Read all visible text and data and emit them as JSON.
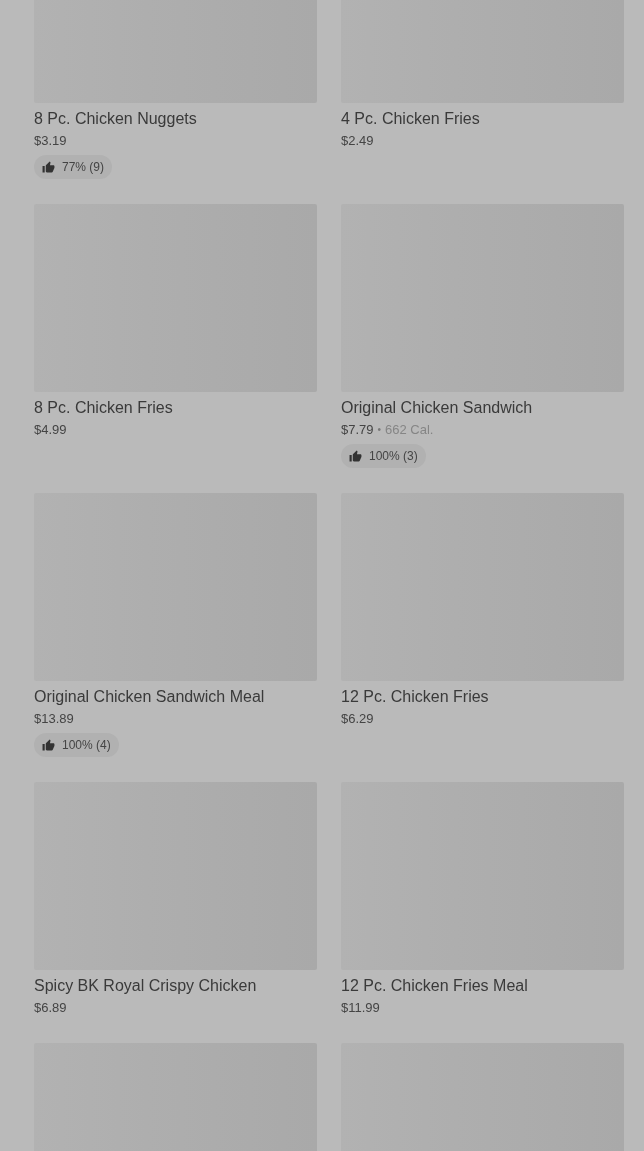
{
  "menu_items": [
    {
      "name": "8 Pc. Chicken Nuggets",
      "price": "$3.19",
      "rating": "77% (9)"
    },
    {
      "name": "4 Pc. Chicken Fries",
      "price": "$2.49"
    },
    {
      "name": "8 Pc. Chicken Fries",
      "price": "$4.99"
    },
    {
      "name": "Original Chicken Sandwich",
      "price": "$7.79",
      "separator": "•",
      "calories": "662 Cal.",
      "rating": "100% (3)"
    },
    {
      "name": "Original Chicken Sandwich Meal",
      "price": "$13.89",
      "rating": "100% (4)"
    },
    {
      "name": "12 Pc. Chicken Fries",
      "price": "$6.29"
    },
    {
      "name": "Spicy BK Royal Crispy Chicken",
      "price": "$6.89"
    },
    {
      "name": "12 Pc. Chicken Fries Meal",
      "price": "$11.99"
    },
    {
      "kind": "image_only"
    },
    {
      "kind": "image_only"
    }
  ]
}
